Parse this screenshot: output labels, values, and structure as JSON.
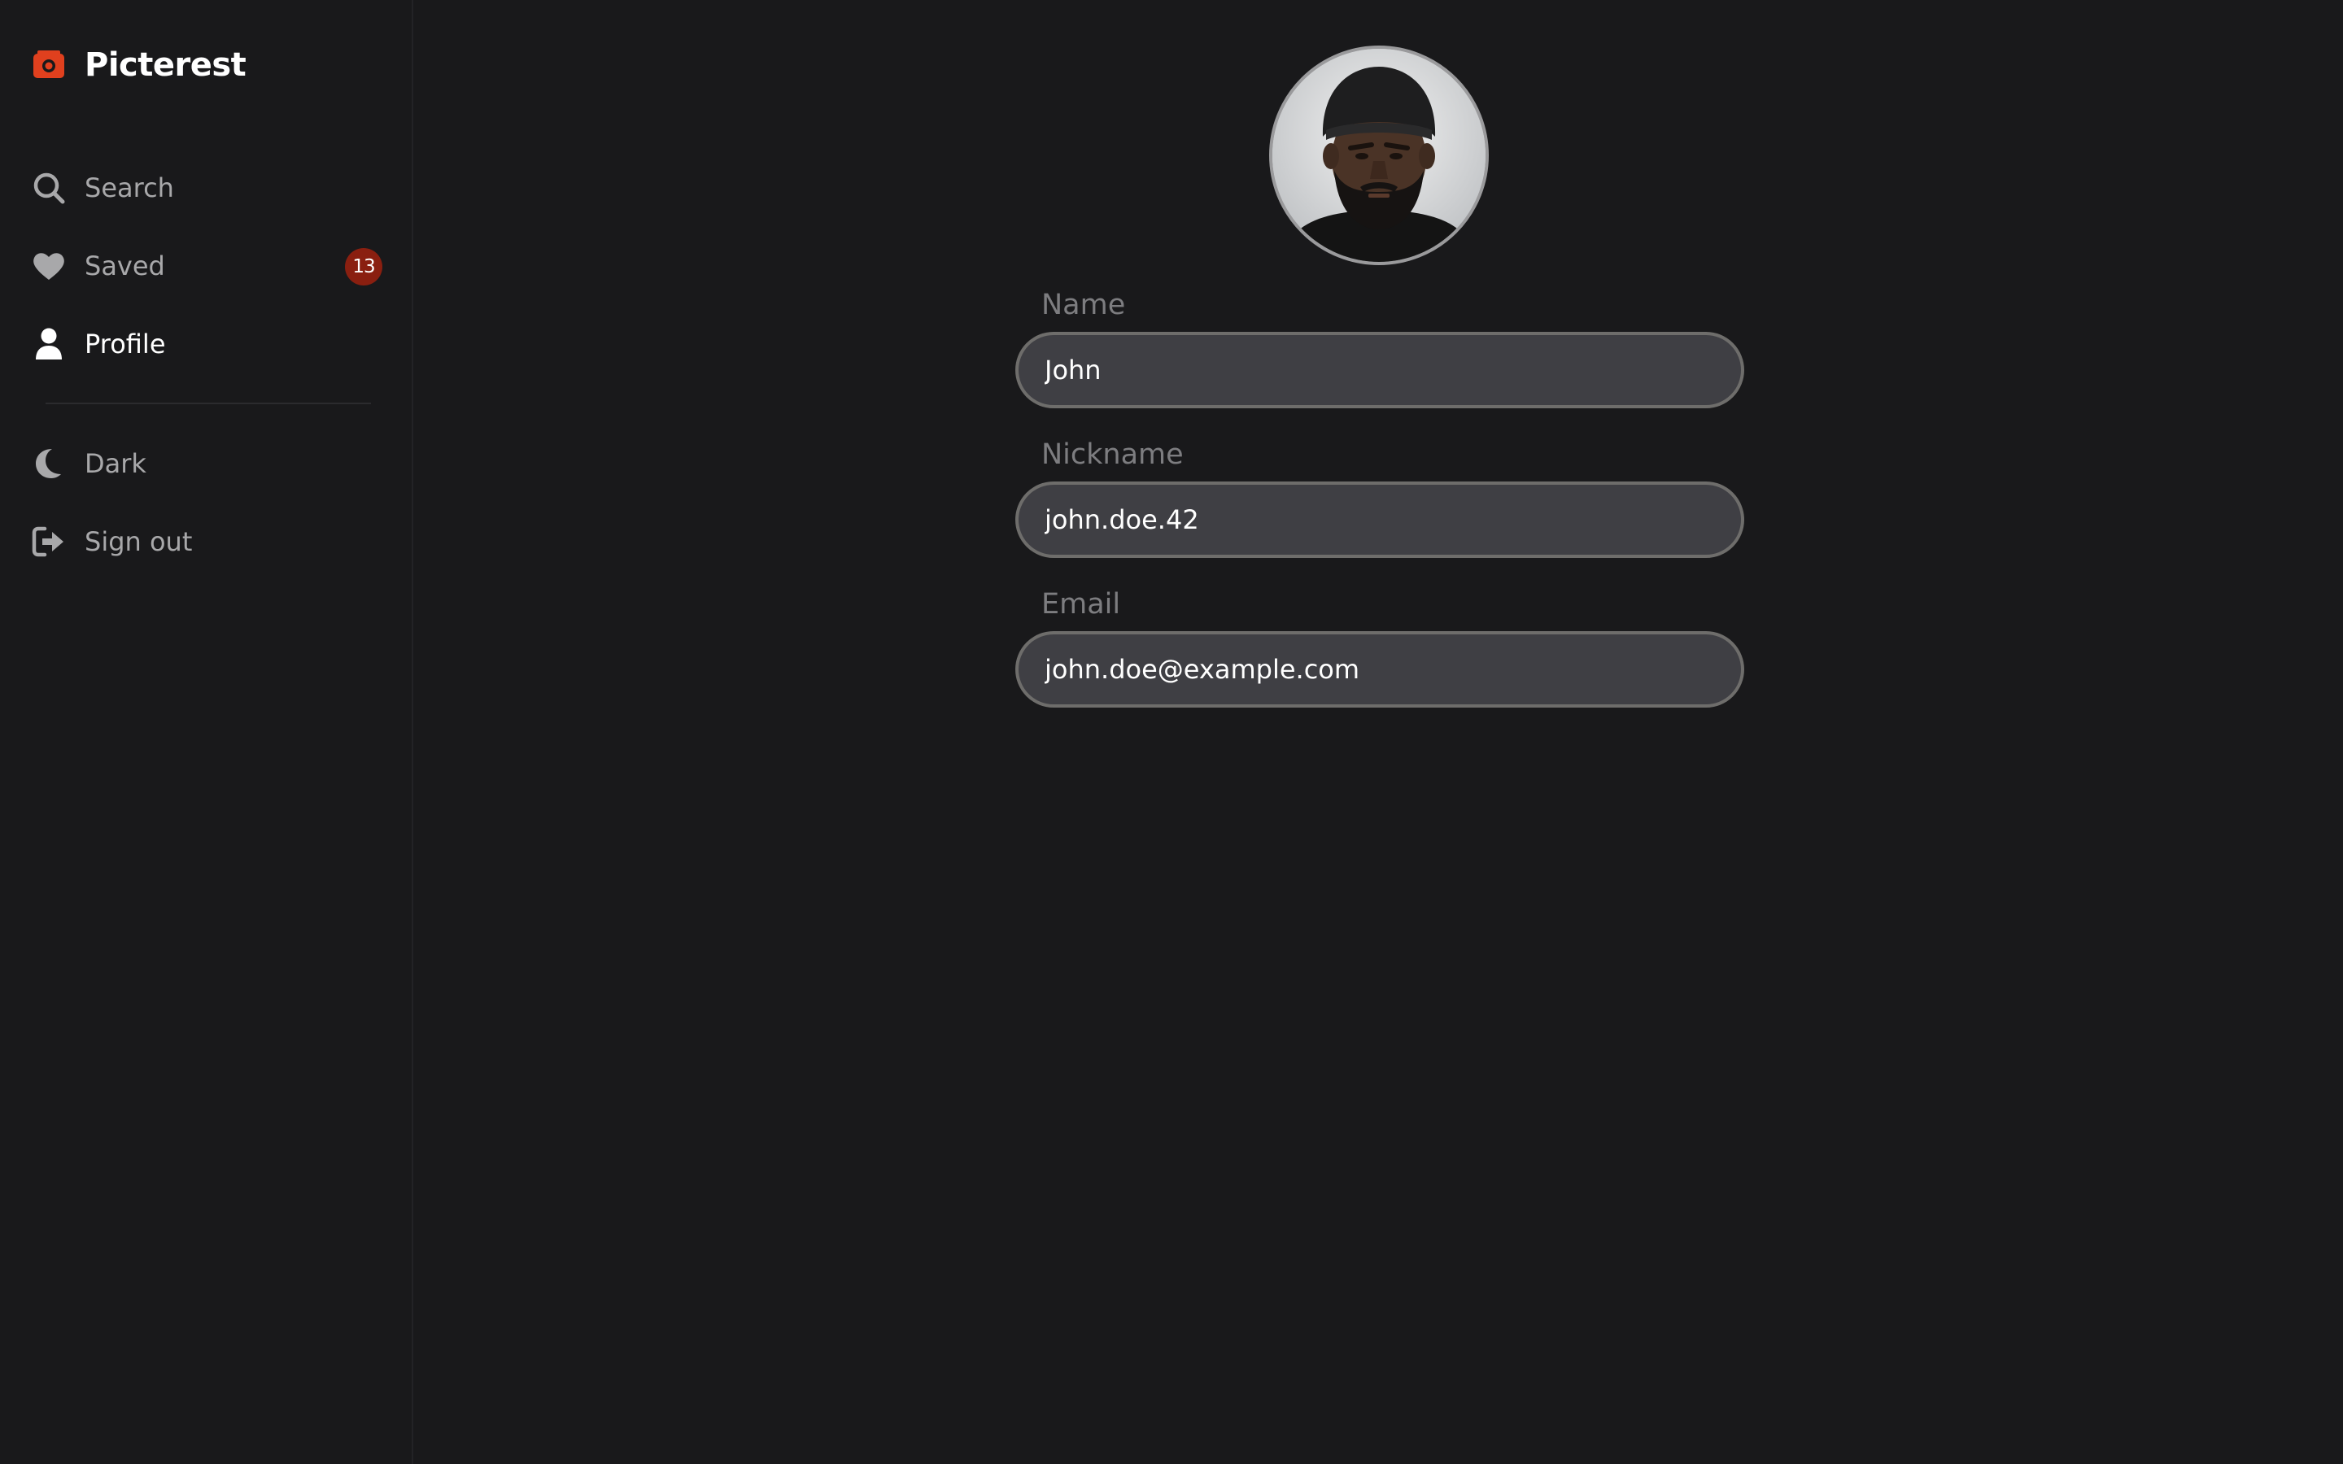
{
  "app": {
    "brand": "Picterest",
    "accent_color": "#e0401e"
  },
  "sidebar": {
    "items": [
      {
        "label": "Search",
        "icon": "search-icon"
      },
      {
        "label": "Saved",
        "icon": "heart-icon",
        "badge": "13"
      },
      {
        "label": "Profile",
        "icon": "user-icon",
        "active": true
      },
      {
        "label": "Dark",
        "icon": "moon-icon"
      },
      {
        "label": "Sign out",
        "icon": "sign-out-icon"
      }
    ]
  },
  "profile": {
    "avatar_alt": "Profile photo",
    "fields": {
      "name": {
        "label": "Name",
        "value": "John"
      },
      "nickname": {
        "label": "Nickname",
        "value": "john.doe.42"
      },
      "email": {
        "label": "Email",
        "value": "john.doe@example.com"
      }
    }
  },
  "colors": {
    "background": "#19191b",
    "input_background": "#3f3f44",
    "input_border": "#6e6d6b",
    "badge": "#8a1f10"
  }
}
